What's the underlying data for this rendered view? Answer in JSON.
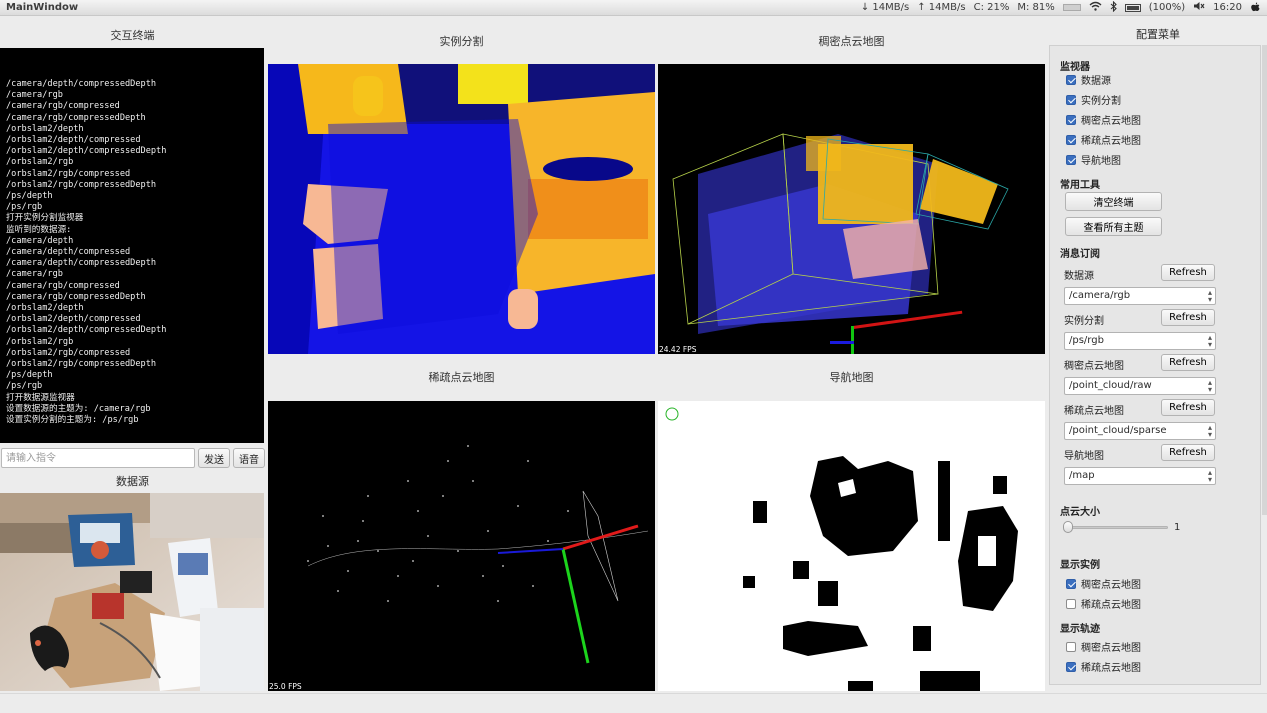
{
  "topbar": {
    "window_title": "MainWindow",
    "net_down": "↓ 14MB/s",
    "net_up": "↑ 14MB/s",
    "cpu": "C: 21%",
    "mem": "M: 81%",
    "battery": "(100%)",
    "time": "16:20"
  },
  "left": {
    "terminal_title": "交互终端",
    "terminal_lines": [
      "/camera/depth/compressedDepth",
      "/camera/rgb",
      "/camera/rgb/compressed",
      "/camera/rgb/compressedDepth",
      "/orbslam2/depth",
      "/orbslam2/depth/compressed",
      "/orbslam2/depth/compressedDepth",
      "/orbslam2/rgb",
      "/orbslam2/rgb/compressed",
      "/orbslam2/rgb/compressedDepth",
      "/ps/depth",
      "/ps/rgb",
      "打开实例分割监视器",
      "监听到的数据源:",
      "/camera/depth",
      "/camera/depth/compressed",
      "/camera/depth/compressedDepth",
      "/camera/rgb",
      "/camera/rgb/compressed",
      "/camera/rgb/compressedDepth",
      "/orbslam2/depth",
      "/orbslam2/depth/compressed",
      "/orbslam2/depth/compressedDepth",
      "/orbslam2/rgb",
      "/orbslam2/rgb/compressed",
      "/orbslam2/rgb/compressedDepth",
      "/ps/depth",
      "/ps/rgb",
      "打开数据源监视器",
      "设置数据源的主题为: /camera/rgb",
      "设置实例分割的主题为: /ps/rgb"
    ],
    "cmd_placeholder": "请输入指令",
    "send_label": "发送",
    "voice_label": "语音",
    "source_title": "数据源"
  },
  "center": {
    "seg_title": "实例分割",
    "dense_title": "稠密点云地图",
    "sparse_title": "稀疏点云地图",
    "nav_title": "导航地图",
    "dense_fps": "24.42 FPS",
    "sparse_fps": "25.0 FPS"
  },
  "config": {
    "title": "配置菜单",
    "monitor_group": "监视器",
    "monitor_items": [
      {
        "label": "数据源",
        "checked": true
      },
      {
        "label": "实例分割",
        "checked": true
      },
      {
        "label": "稠密点云地图",
        "checked": true
      },
      {
        "label": "稀疏点云地图",
        "checked": true
      },
      {
        "label": "导航地图",
        "checked": true
      }
    ],
    "tools_group": "常用工具",
    "clear_terminal": "清空终端",
    "view_topics": "查看所有主题",
    "subscribe_group": "消息订阅",
    "subscriptions": [
      {
        "label": "数据源",
        "refresh": "Refresh",
        "topic": "/camera/rgb"
      },
      {
        "label": "实例分割",
        "refresh": "Refresh",
        "topic": "/ps/rgb"
      },
      {
        "label": "稠密点云地图",
        "refresh": "Refresh",
        "topic": "/point_cloud/raw"
      },
      {
        "label": "稀疏点云地图",
        "refresh": "Refresh",
        "topic": "/point_cloud/sparse"
      },
      {
        "label": "导航地图",
        "refresh": "Refresh",
        "topic": "/map"
      }
    ],
    "pointsize_group": "点云大小",
    "pointsize_value": "1",
    "instance_group": "显示实例",
    "instance_items": [
      {
        "label": "稠密点云地图",
        "checked": true
      },
      {
        "label": "稀疏点云地图",
        "checked": false
      }
    ],
    "trajectory_group": "显示轨迹",
    "trajectory_items": [
      {
        "label": "稠密点云地图",
        "checked": false
      },
      {
        "label": "稀疏点云地图",
        "checked": true
      }
    ]
  }
}
